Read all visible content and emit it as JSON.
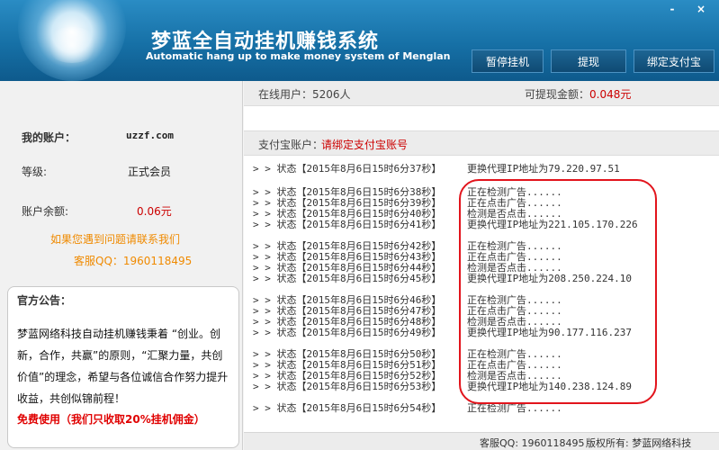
{
  "app": {
    "title_cn": "梦蓝全自动挂机赚钱系统",
    "title_en": "Automatic hang up to make money system of Menglan",
    "minimize_label": "-",
    "close_label": "×"
  },
  "toolbar": {
    "pause_label": "暂停挂机",
    "withdraw_label": "提现",
    "bind_label": "绑定支付宝"
  },
  "account": {
    "my_account_label": "我的账户：",
    "my_account_value": "uzzf.com",
    "level_label": "等级:",
    "level_value": "正式会员",
    "balance_label": "账户余额:",
    "balance_value": "0.06元",
    "help_text": "如果您遇到问题请联系我们",
    "service_qq": "客服QQ：1960118495"
  },
  "notice": {
    "title": "官方公告：",
    "body": "梦蓝网络科技自动挂机赚钱秉着 “创业。创新，合作，共赢”的原则，“汇聚力量，共创价值”的理念，希望与各位诚信合作努力提升收益，共创似锦前程！",
    "free_text": "免费使用（我们只收取20%挂机佣金）"
  },
  "stats": {
    "online_label": "在线用户：",
    "online_value": "5206人",
    "withdrawable_label": "可提现金额：",
    "withdrawable_value": "0.048元"
  },
  "alipay": {
    "label": "支付宝账户：",
    "link": "请绑定支付宝账号"
  },
  "log": [
    {
      "status": "> > 状态【2015年8月6日15时6分37秒】",
      "msg": "更换代理IP地址为79.220.97.51"
    },
    {
      "status": "> > 状态【2015年8月6日15时6分38秒】",
      "msg": "正在检测广告......"
    },
    {
      "status": "> > 状态【2015年8月6日15时6分39秒】",
      "msg": "正在点击广告......"
    },
    {
      "status": "> > 状态【2015年8月6日15时6分40秒】",
      "msg": "检测是否点击......"
    },
    {
      "status": "> > 状态【2015年8月6日15时6分41秒】",
      "msg": "更换代理IP地址为221.105.170.226"
    },
    {
      "status": "> > 状态【2015年8月6日15时6分42秒】",
      "msg": "正在检测广告......"
    },
    {
      "status": "> > 状态【2015年8月6日15时6分43秒】",
      "msg": "正在点击广告......"
    },
    {
      "status": "> > 状态【2015年8月6日15时6分44秒】",
      "msg": "检测是否点击......"
    },
    {
      "status": "> > 状态【2015年8月6日15时6分45秒】",
      "msg": "更换代理IP地址为208.250.224.10"
    },
    {
      "status": "> > 状态【2015年8月6日15时6分46秒】",
      "msg": "正在检测广告......"
    },
    {
      "status": "> > 状态【2015年8月6日15时6分47秒】",
      "msg": "正在点击广告......"
    },
    {
      "status": "> > 状态【2015年8月6日15时6分48秒】",
      "msg": "检测是否点击......"
    },
    {
      "status": "> > 状态【2015年8月6日15时6分49秒】",
      "msg": "更换代理IP地址为90.177.116.237"
    },
    {
      "status": "> > 状态【2015年8月6日15时6分50秒】",
      "msg": "正在检测广告......"
    },
    {
      "status": "> > 状态【2015年8月6日15时6分51秒】",
      "msg": "正在点击广告......"
    },
    {
      "status": "> > 状态【2015年8月6日15时6分52秒】",
      "msg": "检测是否点击......"
    },
    {
      "status": "> > 状态【2015年8月6日15时6分53秒】",
      "msg": "更换代理IP地址为140.238.124.89"
    },
    {
      "status": "> > 状态【2015年8月6日15时6分54秒】",
      "msg": "正在检测广告......"
    }
  ],
  "footer": {
    "qq": "客服QQ: 1960118495",
    "copyright": "版权所有: 梦蓝网络科技"
  },
  "colors": {
    "header_blue": "#1670a6",
    "accent_red": "#cc0000",
    "help_orange": "#f08a00",
    "highlight_red": "#e2141c"
  }
}
